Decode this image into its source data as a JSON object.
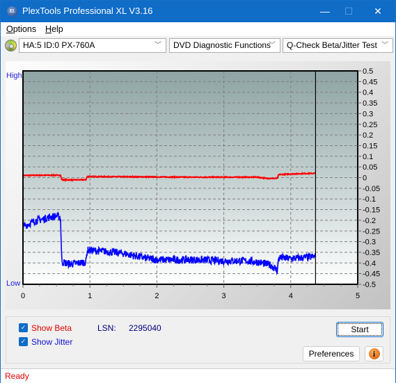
{
  "window": {
    "title": "PlexTools Professional XL V3.16",
    "app_icon_label": "XL",
    "minimize_glyph": "—",
    "maximize_glyph": "☐",
    "close_glyph": "✕"
  },
  "menu": {
    "items": [
      {
        "label": "Options",
        "accel": "O",
        "rest": "ptions"
      },
      {
        "label": "Help",
        "accel": "H",
        "rest": "elp"
      }
    ]
  },
  "toolbar": {
    "drive_select": "HA:5 ID:0  PX-760A",
    "function_select": "DVD Diagnostic Functions",
    "test_select": "Q-Check Beta/Jitter Test",
    "chevron_glyph": "﹀"
  },
  "chart_data": {
    "type": "line",
    "title": "",
    "xlabel": "",
    "ylabel": "",
    "left_axis_labels": {
      "top": "High",
      "bottom": "Low"
    },
    "xlim": [
      0,
      5
    ],
    "ylim": [
      -0.5,
      0.5
    ],
    "x_ticks": [
      0,
      1,
      2,
      3,
      4,
      5
    ],
    "y_ticks": [
      0.5,
      0.45,
      0.4,
      0.35,
      0.3,
      0.25,
      0.2,
      0.15,
      0.1,
      0.05,
      0,
      -0.05,
      -0.1,
      -0.15,
      -0.2,
      -0.25,
      -0.3,
      -0.35,
      -0.4,
      -0.45,
      -0.5
    ],
    "grid": true,
    "cursor_x": 4.37,
    "colors": {
      "beta": "#ff0000",
      "jitter": "#0000ff",
      "cursor": "#000000"
    },
    "series": [
      {
        "name": "Beta",
        "x": [
          0,
          0.3,
          0.56,
          0.58,
          0.75,
          0.94,
          0.96,
          1.5,
          2.0,
          2.5,
          3.0,
          3.5,
          3.65,
          3.8,
          3.82,
          4.0,
          4.2,
          4.37
        ],
        "values": [
          0.01,
          0.011,
          0.011,
          -0.01,
          -0.011,
          -0.01,
          0.005,
          0.004,
          0.003,
          0.002,
          0.002,
          0.002,
          -0.004,
          -0.004,
          0.014,
          0.017,
          0.019,
          0.02
        ]
      },
      {
        "name": "Jitter",
        "x": [
          0,
          0.1,
          0.2,
          0.3,
          0.4,
          0.5,
          0.56,
          0.58,
          0.7,
          0.85,
          0.94,
          0.96,
          1.2,
          1.5,
          1.8,
          2.0,
          2.3,
          2.6,
          3.0,
          3.3,
          3.5,
          3.7,
          3.8,
          3.82,
          4.0,
          4.2,
          4.37
        ],
        "values": [
          -0.23,
          -0.215,
          -0.2,
          -0.195,
          -0.185,
          -0.18,
          -0.185,
          -0.395,
          -0.405,
          -0.4,
          -0.395,
          -0.34,
          -0.345,
          -0.355,
          -0.375,
          -0.385,
          -0.385,
          -0.385,
          -0.39,
          -0.39,
          -0.395,
          -0.41,
          -0.435,
          -0.375,
          -0.38,
          -0.375,
          -0.37
        ]
      }
    ]
  },
  "controls": {
    "show_beta_label": "Show Beta",
    "show_beta_checked": true,
    "show_jitter_label": "Show Jitter",
    "show_jitter_checked": true,
    "lsn_label": "LSN:",
    "lsn_value": "2295040",
    "start_label": "Start",
    "preferences_label": "Preferences",
    "info_glyph": "i",
    "check_glyph": "✓"
  },
  "status": {
    "text": "Ready"
  }
}
